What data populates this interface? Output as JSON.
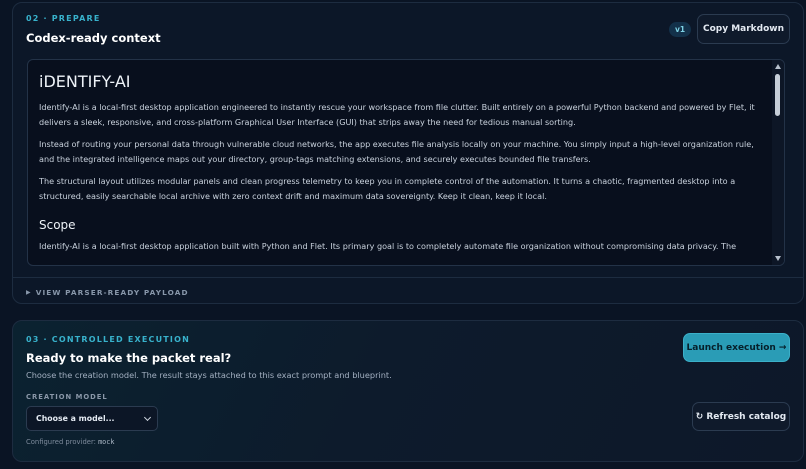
{
  "prepare": {
    "step_label": "02 · PREPARE",
    "title": "Codex-ready context",
    "version_badge": "v1",
    "copy_button_label": "Copy Markdown",
    "document": {
      "heading": "iDENTIFY-AI",
      "paragraphs": [
        "Identify-AI is a local-first desktop application engineered to instantly rescue your workspace from file clutter. Built entirely on a powerful Python backend and powered by Flet, it delivers a sleek, responsive, and cross-platform Graphical User Interface (GUI) that strips away the need for tedious manual sorting.",
        "Instead of routing your personal data through vulnerable cloud networks, the app executes file analysis locally on your machine. You simply input a high-level organization rule, and the integrated intelligence maps out your directory, group-tags matching extensions, and securely executes bounded file transfers.",
        "The structural layout utilizes modular panels and clean progress telemetry to keep you in complete control of the automation. It turns a chaotic, fragmented desktop into a structured, easily searchable local archive with zero context drift and maximum data sovereignty. Keep it clean, keep it local."
      ],
      "subheading": "Scope",
      "scope_text": "Identify-AI is a local-first desktop application built with Python and Flet. Its primary goal is to completely automate file organization without compromising data privacy. The"
    },
    "payload_toggle_label": "VIEW PARSER-READY PAYLOAD"
  },
  "execution": {
    "step_label": "03 · CONTROLLED EXECUTION",
    "title": "Ready to make the packet real?",
    "subtitle": "Choose the creation model. The result stays attached to this exact prompt and blueprint.",
    "model_label": "CREATION MODEL",
    "model_select_value": "Choose a model...",
    "provider_prefix": "Configured provider:",
    "provider_value": "mock",
    "launch_button_label": "Launch execution →",
    "refresh_button_label": "Refresh catalog"
  },
  "colors": {
    "accent": "#38b2cc",
    "launch_button": "#2a9cb6",
    "background": "#0a1424"
  }
}
